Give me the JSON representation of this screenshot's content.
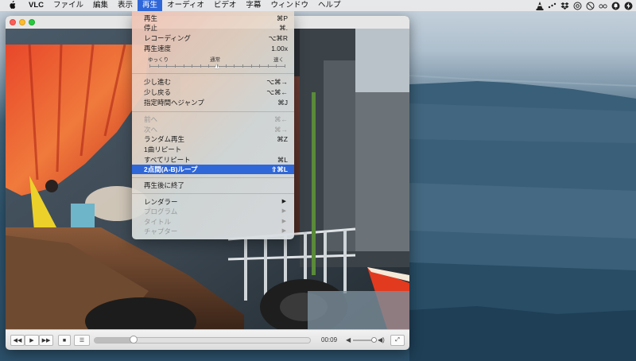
{
  "menubar": {
    "apple_icon": "apple-icon",
    "items": [
      {
        "label": "VLC"
      },
      {
        "label": "ファイル"
      },
      {
        "label": "編集"
      },
      {
        "label": "表示"
      },
      {
        "label": "再生"
      },
      {
        "label": "オーディオ"
      },
      {
        "label": "ビデオ"
      },
      {
        "label": "字幕"
      },
      {
        "label": "ウィンドウ"
      },
      {
        "label": "ヘルプ"
      }
    ],
    "active_index": 4,
    "status_icons": [
      "vlc-cone-icon",
      "dots-icon",
      "dropbox-icon",
      "at-icon",
      "ban-icon",
      "glasses-icon",
      "bell-icon",
      "bolt-icon"
    ]
  },
  "playback_menu": {
    "items": [
      {
        "label": "再生",
        "shortcut": "⌘P"
      },
      {
        "label": "停止",
        "shortcut": "⌘."
      },
      {
        "label": "レコーディング",
        "shortcut": "⌥⌘R"
      },
      {
        "label": "再生速度",
        "shortcut": "1.00x"
      }
    ],
    "speed": {
      "slow": "ゆっくり",
      "normal": "通常",
      "fast": "速く",
      "position": 0.5
    },
    "items2": [
      {
        "label": "少し進む",
        "shortcut": "⌥⌘→"
      },
      {
        "label": "少し戻る",
        "shortcut": "⌥⌘←"
      },
      {
        "label": "指定時間へジャンプ",
        "shortcut": "⌘J"
      }
    ],
    "items3": [
      {
        "label": "前へ",
        "shortcut": "⌘←",
        "disabled": true
      },
      {
        "label": "次へ",
        "shortcut": "⌘→",
        "disabled": true
      },
      {
        "label": "ランダム再生",
        "shortcut": "⌘Z"
      },
      {
        "label": "1曲リピート",
        "shortcut": ""
      },
      {
        "label": "すべてリピート",
        "shortcut": "⌘L"
      },
      {
        "label": "2点間(A-B)ループ",
        "shortcut": "⇧⌘L",
        "highlighted": true
      }
    ],
    "items4": [
      {
        "label": "再生後に終了",
        "shortcut": ""
      }
    ],
    "items5": [
      {
        "label": "レンダラー",
        "submenu": true,
        "disabled": false
      },
      {
        "label": "プログラム",
        "submenu": true,
        "disabled": true
      },
      {
        "label": "タイトル",
        "submenu": true,
        "disabled": true
      },
      {
        "label": "チャプター",
        "submenu": true,
        "disabled": true
      }
    ],
    "submenu_arrow": "▶"
  },
  "player": {
    "rewind_icon": "◀◀",
    "play_icon": "▶",
    "forward_icon": "▶▶",
    "stop_icon": "■",
    "playlist_icon": "☰",
    "fullscreen_icon": "⤢",
    "progress": 0.18,
    "time": "00:09",
    "volume": 0.85,
    "volume_low_icon": "◀",
    "volume_high_icon": "◀)"
  },
  "colors": {
    "accent": "#2f67d9"
  }
}
